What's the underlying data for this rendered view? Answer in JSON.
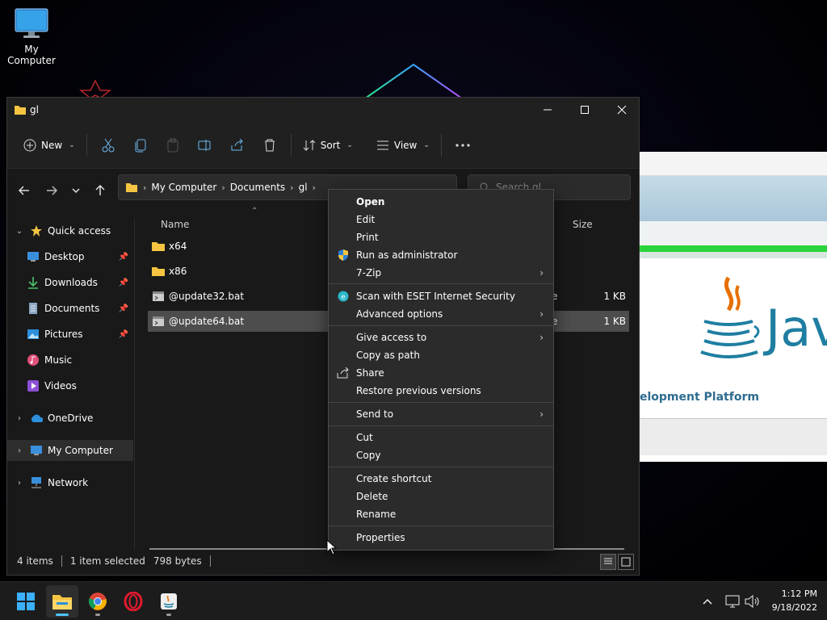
{
  "desktop": {
    "icon_label": "My Computer",
    "java_text": "elopment Platform",
    "java_word": "Jav"
  },
  "explorer": {
    "title": "gl",
    "toolbar": {
      "new_label": "New",
      "sort_label": "Sort",
      "view_label": "View"
    },
    "address": {
      "crumbs": [
        "My Computer",
        "Documents",
        "gl"
      ]
    },
    "search": {
      "placeholder": "Search gl"
    },
    "columns": {
      "name": "Name",
      "size": "Size"
    },
    "sidebar": {
      "items": [
        {
          "label": "Quick access"
        },
        {
          "label": "Desktop"
        },
        {
          "label": "Downloads"
        },
        {
          "label": "Documents"
        },
        {
          "label": "Pictures"
        },
        {
          "label": "Music"
        },
        {
          "label": "Videos"
        },
        {
          "label": "OneDrive"
        },
        {
          "label": "My Computer"
        },
        {
          "label": "Network"
        }
      ]
    },
    "files": [
      {
        "name": "x64",
        "type": "",
        "size": ""
      },
      {
        "name": "x86",
        "type": "",
        "size": ""
      },
      {
        "name": "@update32.bat",
        "type": "e",
        "size": "1 KB"
      },
      {
        "name": "@update64.bat",
        "type": "e",
        "size": "1 KB"
      }
    ],
    "status": {
      "count": "4 items",
      "selected": "1 item selected",
      "bytes": "798 bytes"
    }
  },
  "context_menu": {
    "items": [
      {
        "label": "Open"
      },
      {
        "label": "Edit"
      },
      {
        "label": "Print"
      },
      {
        "label": "Run as administrator"
      },
      {
        "label": "7-Zip"
      },
      {
        "label": "Scan with ESET Internet Security"
      },
      {
        "label": "Advanced options"
      },
      {
        "label": "Give access to"
      },
      {
        "label": "Copy as path"
      },
      {
        "label": "Share"
      },
      {
        "label": "Restore previous versions"
      },
      {
        "label": "Send to"
      },
      {
        "label": "Cut"
      },
      {
        "label": "Copy"
      },
      {
        "label": "Create shortcut"
      },
      {
        "label": "Delete"
      },
      {
        "label": "Rename"
      },
      {
        "label": "Properties"
      }
    ]
  },
  "taskbar": {
    "time": "1:12 PM",
    "date": "9/18/2022"
  },
  "colors": {
    "accent": "#4fc3f7",
    "folder": "#f5c542",
    "selection": "#4d4d4d"
  }
}
